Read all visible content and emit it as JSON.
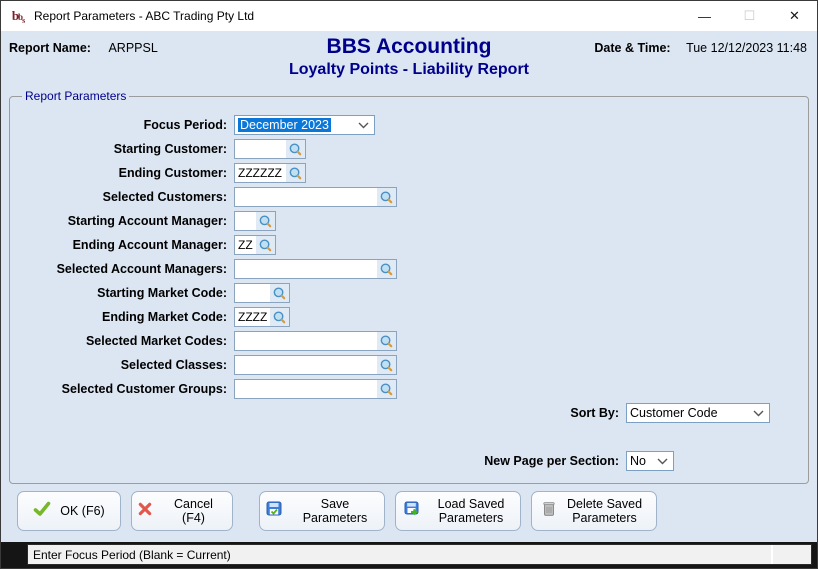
{
  "window": {
    "title": "Report Parameters - ABC Trading Pty Ltd",
    "controls": {
      "minimize": "—",
      "maximize": "☐",
      "close": "✕"
    }
  },
  "header": {
    "report_name_label": "Report Name:",
    "report_name_value": "ARPPSL",
    "app_title": "BBS Accounting",
    "report_title": "Loyalty Points - Liability Report",
    "datetime_label": "Date & Time:",
    "datetime_value": "Tue 12/12/2023 11:48"
  },
  "parameters": {
    "group_label": "Report Parameters",
    "fields": [
      {
        "label": "Focus Period:",
        "value": "December 2023",
        "type": "dropdown"
      },
      {
        "label": "Starting Customer:",
        "value": "",
        "type": "lookup"
      },
      {
        "label": "Ending Customer:",
        "value": "ZZZZZZ",
        "type": "lookup"
      },
      {
        "label": "Selected Customers:",
        "value": "",
        "type": "lookup"
      },
      {
        "label": "Starting Account Manager:",
        "value": "",
        "type": "lookup"
      },
      {
        "label": "Ending Account Manager:",
        "value": "ZZ",
        "type": "lookup"
      },
      {
        "label": "Selected Account Managers:",
        "value": "",
        "type": "lookup"
      },
      {
        "label": "Starting Market Code:",
        "value": "",
        "type": "lookup"
      },
      {
        "label": "Ending Market Code:",
        "value": "ZZZZ",
        "type": "lookup"
      },
      {
        "label": "Selected Market Codes:",
        "value": "",
        "type": "lookup"
      },
      {
        "label": "Selected Classes:",
        "value": "",
        "type": "lookup"
      },
      {
        "label": "Selected Customer Groups:",
        "value": "",
        "type": "lookup"
      }
    ],
    "sort_by": {
      "label": "Sort By:",
      "value": "Customer Code"
    },
    "new_page": {
      "label": "New Page per Section:",
      "value": "No"
    }
  },
  "buttons": [
    {
      "name": "ok",
      "label": "OK (F6)"
    },
    {
      "name": "cancel",
      "label": "Cancel (F4)"
    },
    {
      "name": "save",
      "label": "Save Parameters"
    },
    {
      "name": "load",
      "label": "Load Saved Parameters"
    },
    {
      "name": "delete",
      "label": "Delete Saved Parameters"
    }
  ],
  "statusbar": {
    "message": "Enter Focus Period (Blank = Current)"
  },
  "icons": {
    "titlebar": "bbs-logo",
    "lookup": "magnifier-search",
    "ok": "green-check",
    "cancel": "red-x",
    "save": "save-disk-check",
    "load": "load-disk-arrow",
    "delete": "trash-bin",
    "combo": "chevron-down"
  },
  "colors": {
    "body_bg": "#dce6f3",
    "title_navy": "#00008b",
    "selection_highlight": "#0a77d9",
    "field_border": "#8aa4bf",
    "statusbar_bg": "#151515"
  }
}
